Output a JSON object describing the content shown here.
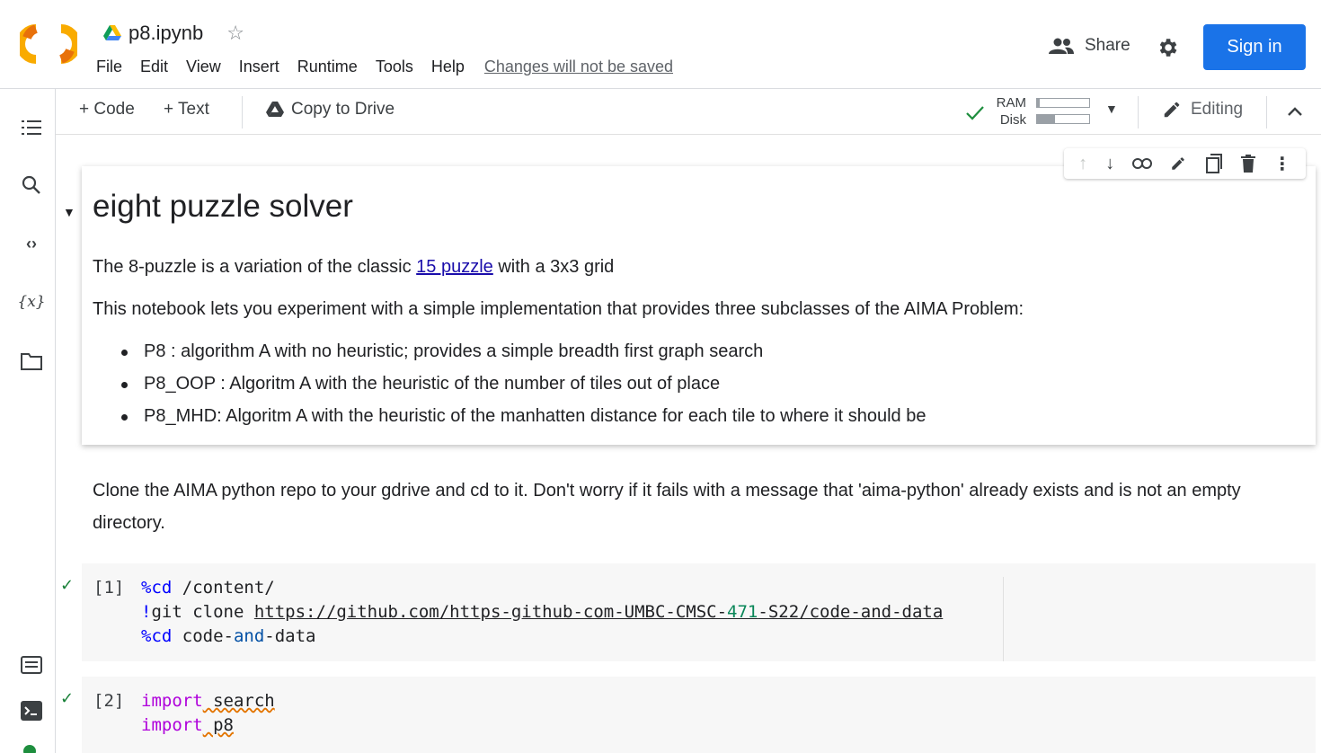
{
  "header": {
    "doc_title": "p8.ipynb",
    "menu": [
      "File",
      "Edit",
      "View",
      "Insert",
      "Runtime",
      "Tools",
      "Help"
    ],
    "unsaved_label": "Changes will not be saved",
    "share_label": "Share",
    "signin_label": "Sign in",
    "accent_color": "#1a73e8"
  },
  "toolbar": {
    "add_code": "+ Code",
    "add_text": "+ Text",
    "copy_to_drive": "Copy to Drive",
    "ram_label": "RAM",
    "disk_label": "Disk",
    "ram_usage": 0.05,
    "disk_usage": 0.35,
    "editing_label": "Editing"
  },
  "rail": {
    "icons": [
      "table-of-contents-icon",
      "search-icon",
      "code-snippets-icon",
      "variables-icon",
      "files-icon",
      "command-palette-icon",
      "terminal-icon"
    ]
  },
  "markdown_cell": {
    "title": "eight puzzle solver",
    "intro_before_link": "The 8-puzzle is a variation of the classic ",
    "intro_link": "15 puzzle",
    "intro_after_link": " with a 3x3 grid",
    "description": "This notebook lets you experiment with a simple implementation that provides three subclasses of the AIMA Problem:",
    "bullets": [
      "P8 : algorithm A with no heuristic; provides a simple breadth first graph search",
      "P8_OOP : Algoritm A with the heuristic of the number of tiles out of place",
      "P8_MHD: Algoritm A with the heuristic of the manhatten distance for each tile to where it should be"
    ]
  },
  "text_cell": {
    "text": "Clone the AIMA python repo to your gdrive and cd to it. Don't worry if it fails with a message that 'aima-python' already exists and is not an empty directory."
  },
  "code_cells": [
    {
      "exec_count": "[1]",
      "line1_magic": "%cd",
      "line1_rest": " /content/",
      "line2_bang": "!git clone ",
      "line2_url_a": "https://github.com/https-github-com-UMBC-CMSC-",
      "line2_url_num": "471",
      "line2_url_b": "-S22/code-and-data",
      "line3_magic": "%cd",
      "line3_a": " code-",
      "line3_and": "and",
      "line3_b": "-data"
    },
    {
      "exec_count": "[2]",
      "line1_kw": "import",
      "line1_mod": " search",
      "line2_kw": "import",
      "line2_mod": " p8"
    }
  ]
}
